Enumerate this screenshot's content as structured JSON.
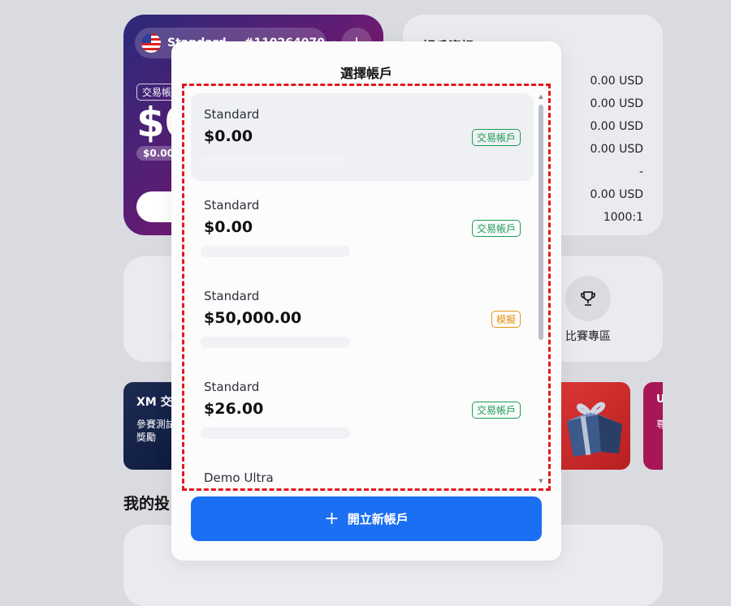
{
  "account_card": {
    "account_type": "Standard",
    "account_number": "#110264070",
    "tag": "交易帳",
    "balance_partial": "$0",
    "sub_balance": "$0.00"
  },
  "info_card": {
    "title": "帳戶資訊",
    "values": [
      "0.00 USD",
      "0.00 USD",
      "0.00 USD",
      "0.00 USD",
      "-",
      "0.00 USD",
      "1000:1"
    ]
  },
  "quick": {
    "left_stub": "新",
    "competition_label": "比賽專區"
  },
  "promo": {
    "title": "XM 交易",
    "subtitle_line1": "參賽測試",
    "subtitle_line2": "獎勵",
    "right_title": "U",
    "right_sub": "尊"
  },
  "section_title": "我的投",
  "modal": {
    "title": "選擇帳戶",
    "accounts": [
      {
        "name": "Standard",
        "balance": "$0.00",
        "badge": "交易帳戶",
        "kind": "real",
        "selected": true
      },
      {
        "name": "Standard",
        "balance": "$0.00",
        "badge": "交易帳戶",
        "kind": "real",
        "selected": false
      },
      {
        "name": "Standard",
        "balance": "$50,000.00",
        "badge": "模擬",
        "kind": "demo",
        "selected": false
      },
      {
        "name": "Standard",
        "balance": "$26.00",
        "badge": "交易帳戶",
        "kind": "real",
        "selected": false
      },
      {
        "name": "Demo Ultra",
        "balance": "",
        "badge": "",
        "kind": "demo",
        "selected": false
      }
    ],
    "new_account_label": "開立新帳戶"
  },
  "colors": {
    "primary_blue": "#1b6ff2",
    "real_badge": "#1c9b52",
    "demo_badge": "#e89315",
    "highlight_dash": "#e0191d"
  }
}
